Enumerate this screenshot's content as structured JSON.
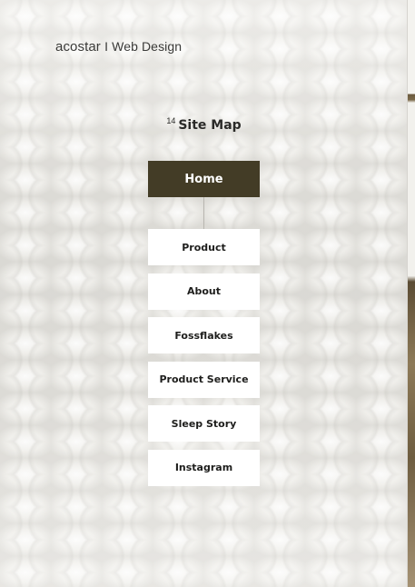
{
  "header": {
    "brand": "acostar",
    "tagline": "I Web Design"
  },
  "section": {
    "number": "14",
    "title": "Site Map"
  },
  "sitemap": {
    "root": "Home",
    "children": [
      "Product",
      "About",
      "Fossflakes",
      "Product Service",
      "Sleep Story",
      "Instagram"
    ]
  },
  "colors": {
    "home_bg": "#433c26",
    "node_bg": "#ffffff",
    "text_dark": "#1e1e1c",
    "connector": "#b8b6b0"
  }
}
